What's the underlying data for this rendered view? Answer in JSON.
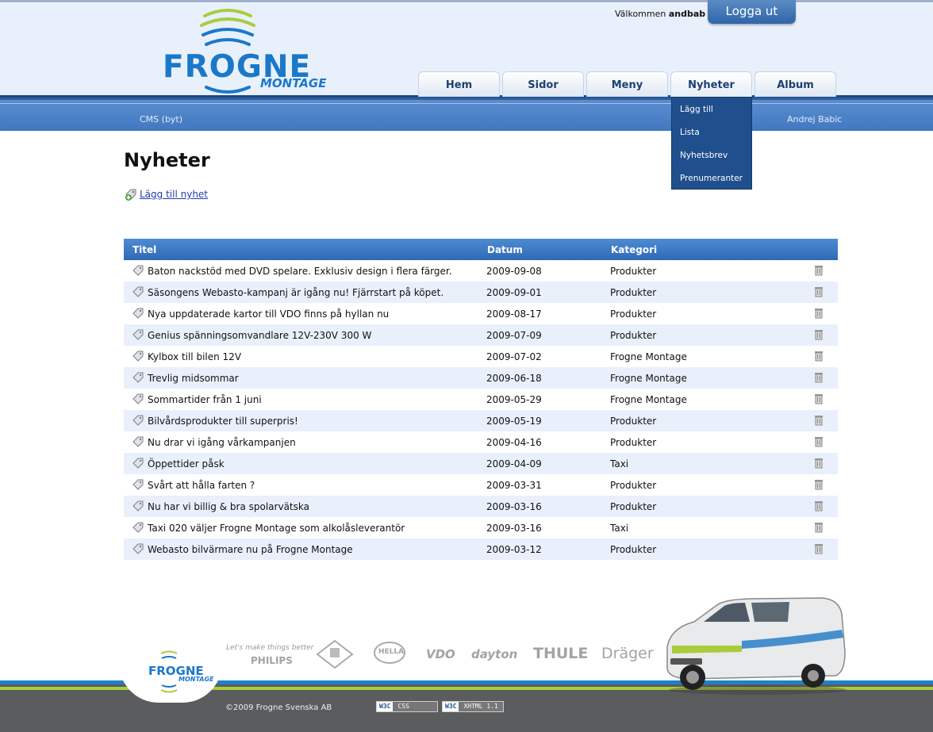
{
  "header": {
    "logo_main": "FROGNE",
    "logo_sub": "MONTAGE",
    "welcome_text": "Välkommen",
    "username": "andbab",
    "logout_label": "Logga ut",
    "cms_link": "CMS (byt)",
    "user_full_name": "Andrej Babic"
  },
  "nav": {
    "tabs": [
      {
        "label": "Hem"
      },
      {
        "label": "Sidor"
      },
      {
        "label": "Meny"
      },
      {
        "label": "Nyheter"
      },
      {
        "label": "Album"
      }
    ],
    "dropdown": [
      {
        "label": "Lägg till"
      },
      {
        "label": "Lista"
      },
      {
        "label": "Nyhetsbrev"
      },
      {
        "label": "Prenumeranter"
      }
    ]
  },
  "main": {
    "title": "Nyheter",
    "add_link": "Lägg till nyhet",
    "columns": [
      "Titel",
      "Datum",
      "Kategori"
    ],
    "rows": [
      {
        "title": "Baton nackstöd med DVD spelare. Exklusiv design i flera färger.",
        "date": "2009-09-08",
        "category": "Produkter"
      },
      {
        "title": "Säsongens Webasto-kampanj är igång nu! Fjärrstart på köpet.",
        "date": "2009-09-01",
        "category": "Produkter"
      },
      {
        "title": "Nya uppdaterade kartor till VDO finns på hyllan nu",
        "date": "2009-08-17",
        "category": "Produkter"
      },
      {
        "title": "Genius spänningsomvandlare 12V-230V 300 W",
        "date": "2009-07-09",
        "category": "Produkter"
      },
      {
        "title": "Kylbox till bilen 12V",
        "date": "2009-07-02",
        "category": "Frogne Montage"
      },
      {
        "title": "Trevlig midsommar",
        "date": "2009-06-18",
        "category": "Frogne Montage"
      },
      {
        "title": "Sommartider från 1 juni",
        "date": "2009-05-29",
        "category": "Frogne Montage"
      },
      {
        "title": "Bilvårdsprodukter till superpris!",
        "date": "2009-05-19",
        "category": "Produkter"
      },
      {
        "title": "Nu drar vi igång vårkampanjen",
        "date": "2009-04-16",
        "category": "Produkter"
      },
      {
        "title": "Öppettider påsk",
        "date": "2009-04-09",
        "category": "Taxi"
      },
      {
        "title": "Svårt att hålla farten ?",
        "date": "2009-03-31",
        "category": "Produkter"
      },
      {
        "title": "Nu har vi billig & bra spolarvätska",
        "date": "2009-03-16",
        "category": "Produkter"
      },
      {
        "title": "Taxi 020 väljer Frogne Montage som alkolåsleverantör",
        "date": "2009-03-16",
        "category": "Taxi"
      },
      {
        "title": "Webasto bilvärmare nu på Frogne Montage",
        "date": "2009-03-12",
        "category": "Produkter"
      }
    ]
  },
  "footer": {
    "logo_main": "FROGNE",
    "logo_sub": "MONTAGE",
    "copyright": "©2009 Frogne Svenska AB",
    "brands": [
      "Let's make things better",
      "PHILIPS",
      "HELLA",
      "VDO",
      "dayton",
      "THULE",
      "Dräger"
    ],
    "badges": [
      {
        "w3c": "W3C",
        "label": "CSS"
      },
      {
        "w3c": "W3C",
        "label": "XHTML 1.1"
      }
    ]
  },
  "colors": {
    "brand_blue": "#1b78c8",
    "nav_blue": "#3f76bf",
    "dropdown_bg": "#1f4f8c",
    "row_alt": "#e9f0fb",
    "accent_green": "#a9cc3e"
  }
}
